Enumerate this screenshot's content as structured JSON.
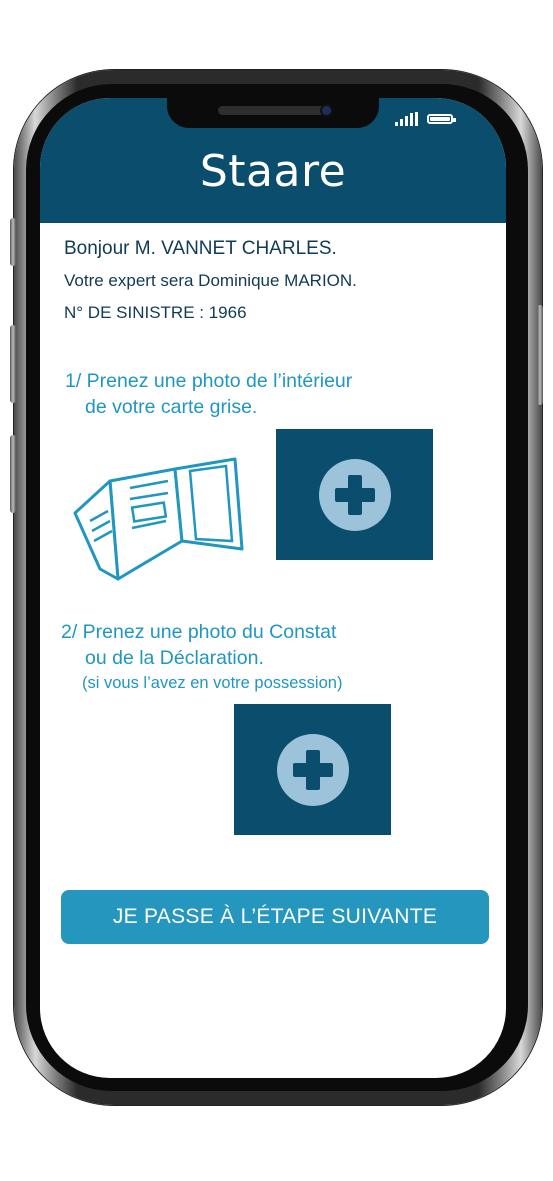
{
  "header": {
    "title": "Staare"
  },
  "status_bar": {
    "signal_icon": "signal-icon",
    "battery_icon": "battery-icon"
  },
  "info": {
    "greeting": "Bonjour M. VANNET CHARLES.",
    "expert": "Votre expert sera Dominique MARION.",
    "claim_number": "N° DE SINISTRE : 1966"
  },
  "step1": {
    "line1": "1/ Prenez une photo de l’intérieur",
    "line2": "de votre carte grise.",
    "illustration_icon": "registration-card-icon",
    "upload_icon": "plus-icon"
  },
  "step2": {
    "line1": "2/ Prenez une photo du Constat",
    "line2": "ou de la Déclaration.",
    "hint": "(si vous l’avez en votre possession)",
    "upload_icon": "plus-icon"
  },
  "next_button": {
    "label": "JE PASSE À L’ÉTAPE SUIVANTE"
  },
  "colors": {
    "header": "#0b4d6d",
    "text_dark": "#113a55",
    "accent": "#1f97c0",
    "button": "#2596be",
    "plus_circle": "#9cc3da"
  }
}
